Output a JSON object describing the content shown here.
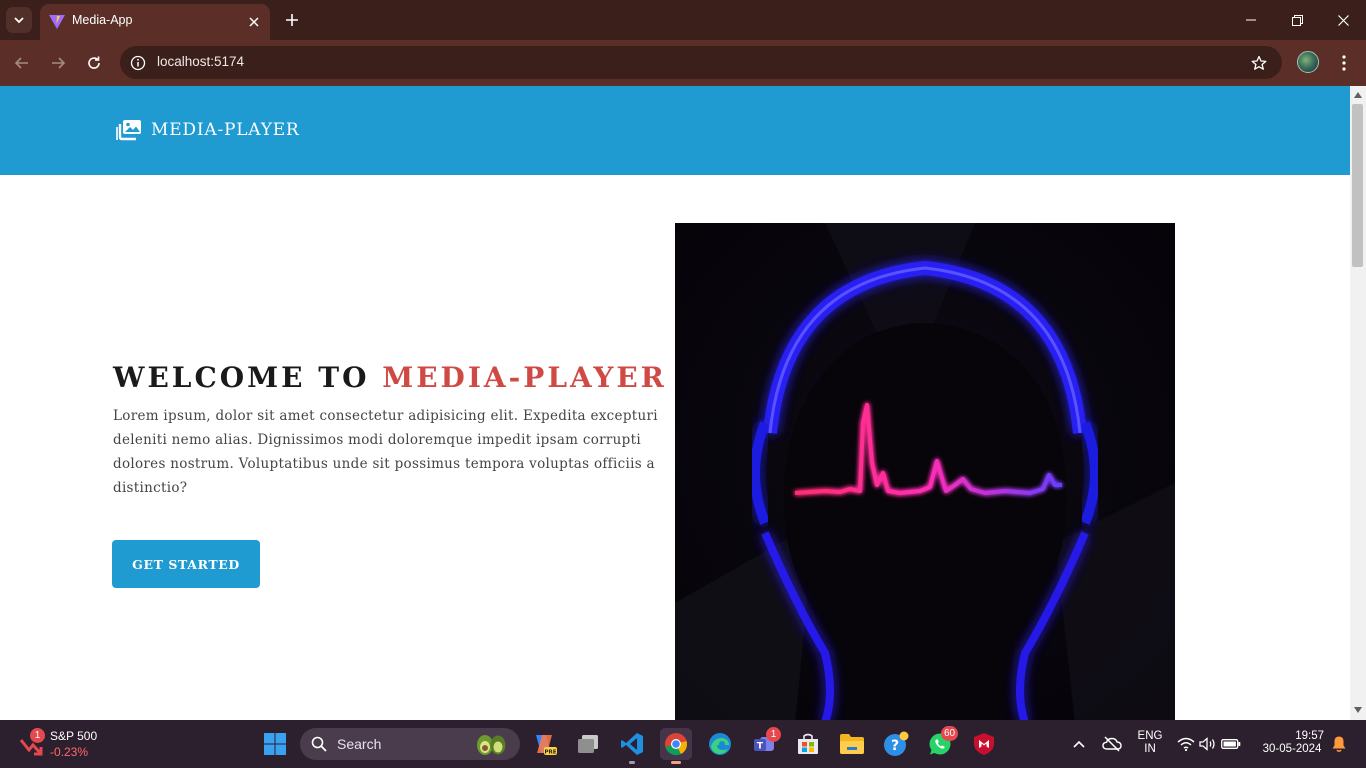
{
  "browser": {
    "tab_title": "Media-App",
    "url": "localhost:5174"
  },
  "page": {
    "brand": "MEDIA-PLAYER",
    "hero": {
      "title_prefix": "WELCOME TO",
      "title_accent": "MEDIA-PLAYER",
      "description": "Lorem ipsum, dolor sit amet consectetur adipisicing elit. Expedita excepturi deleniti nemo alias. Dignissimos modi doloremque impedit ipsam corrupti dolores nostrum. Voluptatibus unde sit possimus tempora voluptas officiis a distinctio?",
      "cta_label": "GET STARTED"
    },
    "colors": {
      "navbar": "#1f9bd1",
      "accent": "#d04a45",
      "button": "#1f9bd1"
    }
  },
  "taskbar": {
    "stock": {
      "name": "S&P 500",
      "change": "-0.23%",
      "badge": "1"
    },
    "search_label": "Search",
    "teams_badge": "1",
    "whatsapp_badge": "60",
    "language": {
      "line1": "ENG",
      "line2": "IN"
    },
    "clock": {
      "time": "19:57",
      "date": "30-05-2024"
    }
  }
}
